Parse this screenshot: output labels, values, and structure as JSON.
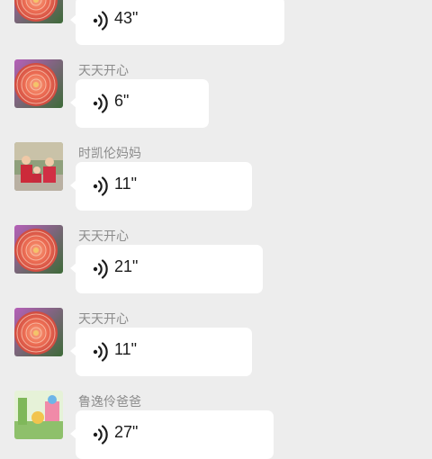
{
  "messages": [
    {
      "name": "",
      "duration": "43\"",
      "avatar": "dahlia-flower-icon"
    },
    {
      "name": "天天开心",
      "duration": "6\"",
      "avatar": "dahlia-flower-icon"
    },
    {
      "name": "时凯伦妈妈",
      "duration": "11\"",
      "avatar": "family-photo-icon"
    },
    {
      "name": "天天开心",
      "duration": "21\"",
      "avatar": "dahlia-flower-icon"
    },
    {
      "name": "天天开心",
      "duration": "11\"",
      "avatar": "dahlia-flower-icon"
    },
    {
      "name": "鲁逸伶爸爸",
      "duration": "27\"",
      "avatar": "cartoon-scene-icon"
    }
  ]
}
